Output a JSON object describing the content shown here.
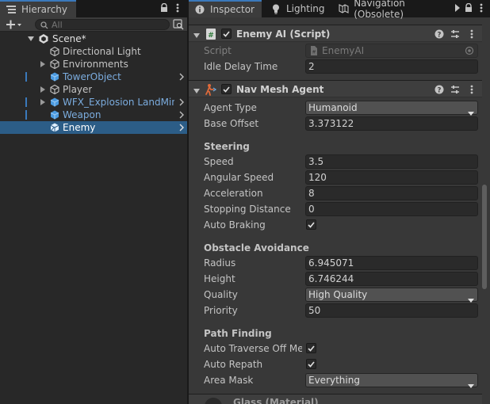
{
  "hierarchy": {
    "tab_label": "Hierarchy",
    "search_placeholder": "All",
    "items": [
      {
        "label": "Scene*",
        "icon": "unity-logo-icon"
      },
      {
        "label": "Directional Light",
        "icon": "gameobject-icon"
      },
      {
        "label": "Environments",
        "icon": "gameobject-icon"
      },
      {
        "label": "TowerObject",
        "icon": "prefab-icon"
      },
      {
        "label": "Player",
        "icon": "gameobject-icon"
      },
      {
        "label": "WFX_Explosion LandMine",
        "icon": "prefab-icon"
      },
      {
        "label": "Weapon",
        "icon": "prefab-icon"
      },
      {
        "label": "Enemy",
        "icon": "prefab-icon"
      }
    ]
  },
  "inspector": {
    "tabs": [
      {
        "label": "Inspector",
        "icon": "info-icon"
      },
      {
        "label": "Lighting",
        "icon": "lightbulb-icon"
      },
      {
        "label": "Navigation (Obsolete)",
        "icon": "navigation-icon"
      }
    ],
    "enemy_ai": {
      "title": "Enemy AI (Script)",
      "script_label": "Script",
      "script_value": "EnemyAI",
      "idle_delay_label": "Idle Delay Time",
      "idle_delay_value": "2"
    },
    "nav_mesh_agent": {
      "title": "Nav Mesh Agent",
      "agent_type_label": "Agent Type",
      "agent_type_value": "Humanoid",
      "base_offset_label": "Base Offset",
      "base_offset_value": "3.373122",
      "steering_header": "Steering",
      "speed_label": "Speed",
      "speed_value": "3.5",
      "angular_speed_label": "Angular Speed",
      "angular_speed_value": "120",
      "acceleration_label": "Acceleration",
      "acceleration_value": "8",
      "stopping_distance_label": "Stopping Distance",
      "stopping_distance_value": "0",
      "auto_braking_label": "Auto Braking",
      "auto_braking_checked": true,
      "obstacle_header": "Obstacle Avoidance",
      "radius_label": "Radius",
      "radius_value": "6.945071",
      "height_label": "Height",
      "height_value": "6.746244",
      "quality_label": "Quality",
      "quality_value": "High Quality",
      "priority_label": "Priority",
      "priority_value": "50",
      "path_header": "Path Finding",
      "auto_traverse_label": "Auto Traverse Off Mes",
      "auto_traverse_checked": true,
      "auto_repath_label": "Auto Repath",
      "auto_repath_checked": true,
      "area_mask_label": "Area Mask",
      "area_mask_value": "Everything"
    },
    "next_component_title": "Glass (Material)"
  },
  "colors": {
    "selection": "#2c5d87",
    "prefab_text": "#7bacde",
    "panel_bg": "#383838",
    "hierarchy_bg": "#282828"
  }
}
